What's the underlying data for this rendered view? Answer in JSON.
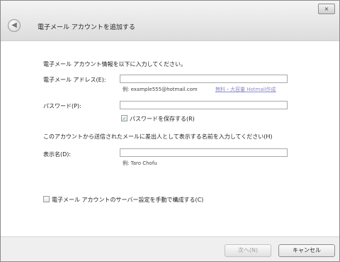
{
  "window": {
    "title": "電子メール アカウントを追加する",
    "close_label": "×",
    "back_icon": "◀"
  },
  "form": {
    "intro": "電子メール アカウント情報を以下に入力してください。",
    "email_label": "電子メール アドレス(E):",
    "email_value": "",
    "email_example": "例: example555@hotmail.com",
    "hotmail_link": "無料・大容量 Hotmail作成",
    "password_label": "パスワード(P):",
    "password_value": "",
    "remember_password_label": "パスワードを保存する(R)",
    "remember_password_checked": true,
    "display_instruction": "このアカウントから送信されたメールに差出人として表示する名前を入力してください(H)",
    "display_name_label": "表示名(D):",
    "display_name_value": "",
    "display_name_example": "例: Taro Chofu",
    "manual_server_label": "電子メール アカウントのサーバー設定を手動で構成する(C)",
    "manual_server_checked": false
  },
  "footer": {
    "next_label": "次へ(N)",
    "cancel_label": "キャンセル"
  },
  "colors": {
    "link": "#8b8bd0",
    "check": "#33aa66"
  }
}
